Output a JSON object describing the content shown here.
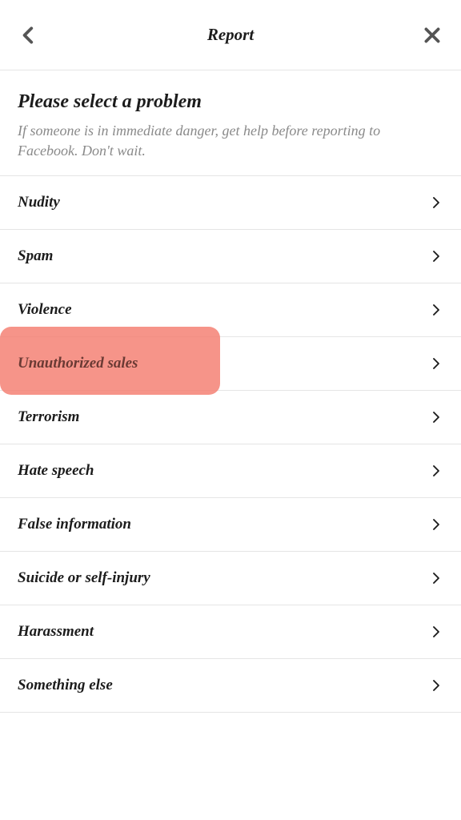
{
  "header": {
    "title": "Report"
  },
  "instructions": {
    "title": "Please select a problem",
    "text": "If someone is in immediate danger, get help before reporting to Facebook. Don't wait."
  },
  "problems": [
    {
      "label": "Nudity",
      "highlighted": false
    },
    {
      "label": "Spam",
      "highlighted": false
    },
    {
      "label": "Violence",
      "highlighted": false
    },
    {
      "label": "Unauthorized sales",
      "highlighted": true
    },
    {
      "label": "Terrorism",
      "highlighted": false
    },
    {
      "label": "Hate speech",
      "highlighted": false
    },
    {
      "label": "False information",
      "highlighted": false
    },
    {
      "label": "Suicide or self-injury",
      "highlighted": false
    },
    {
      "label": "Harassment",
      "highlighted": false
    },
    {
      "label": "Something else",
      "highlighted": false
    }
  ]
}
